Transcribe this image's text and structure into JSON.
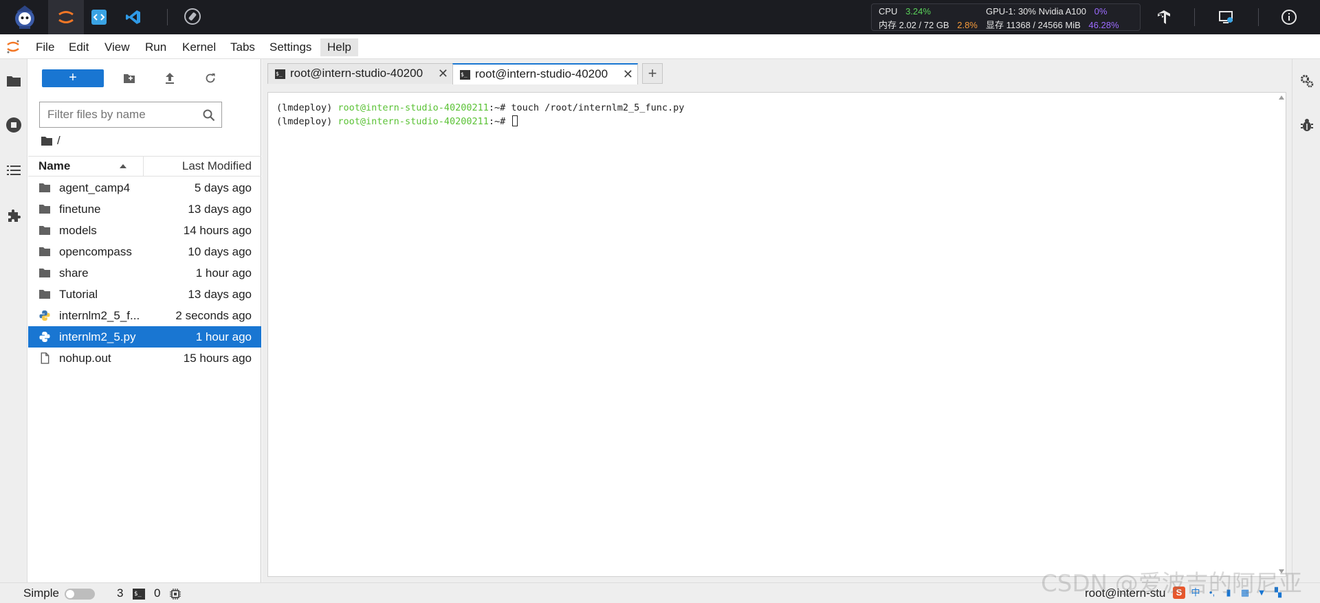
{
  "topbar": {
    "apps": [
      "intern-studio-logo",
      "jupyterlab",
      "code-server",
      "vscode"
    ],
    "monitor": {
      "cpu_label": "CPU",
      "cpu_value": "3.24%",
      "mem_label": "内存 2.02 / 72 GB",
      "mem_value": "2.8%",
      "gpu_label": "GPU-1: 30% Nvidia A100",
      "gpu_value": "0%",
      "vram_label": "显存 11368 / 24566 MiB",
      "vram_value": "46.28%"
    }
  },
  "menu": {
    "items": [
      "File",
      "Edit",
      "View",
      "Run",
      "Kernel",
      "Tabs",
      "Settings",
      "Help"
    ]
  },
  "filebrowser": {
    "new_label": "+",
    "filter_placeholder": "Filter files by name",
    "breadcrumb": "/",
    "col_name": "Name",
    "col_modified": "Last Modified",
    "files": [
      {
        "name": "agent_camp4",
        "modified": "5 days ago",
        "type": "folder",
        "selected": false
      },
      {
        "name": "finetune",
        "modified": "13 days ago",
        "type": "folder",
        "selected": false
      },
      {
        "name": "models",
        "modified": "14 hours ago",
        "type": "folder",
        "selected": false
      },
      {
        "name": "opencompass",
        "modified": "10 days ago",
        "type": "folder",
        "selected": false
      },
      {
        "name": "share",
        "modified": "1 hour ago",
        "type": "folder",
        "selected": false
      },
      {
        "name": "Tutorial",
        "modified": "13 days ago",
        "type": "folder",
        "selected": false
      },
      {
        "name": "internlm2_5_f...",
        "modified": "2 seconds ago",
        "type": "python",
        "selected": false
      },
      {
        "name": "internlm2_5.py",
        "modified": "1 hour ago",
        "type": "python",
        "selected": true
      },
      {
        "name": "nohup.out",
        "modified": "15 hours ago",
        "type": "file",
        "selected": false
      }
    ]
  },
  "tabs": [
    {
      "label": "root@intern-studio-40200",
      "active": false
    },
    {
      "label": "root@intern-studio-40200",
      "active": true
    }
  ],
  "tab_add_label": "+",
  "terminal": {
    "lines": [
      {
        "env": "(lmdeploy) ",
        "host": "root@intern-studio-40200211",
        "path": ":~# ",
        "cmd": "touch /root/internlm2_5_func.py"
      },
      {
        "env": "(lmdeploy) ",
        "host": "root@intern-studio-40200211",
        "path": ":~# ",
        "cmd": ""
      }
    ]
  },
  "statusbar": {
    "mode_label": "Simple",
    "count_a": "3",
    "count_b": "0",
    "right_text": "root@intern-stu"
  },
  "watermark": "CSDN @爱波吉的阿尼亚",
  "colors": {
    "accent": "#1976d2",
    "terminal_host": "#5bc236",
    "cpu_green": "#5ad15a",
    "mem_orange": "#f59a3a",
    "gpu_purple": "#9d6bff"
  }
}
